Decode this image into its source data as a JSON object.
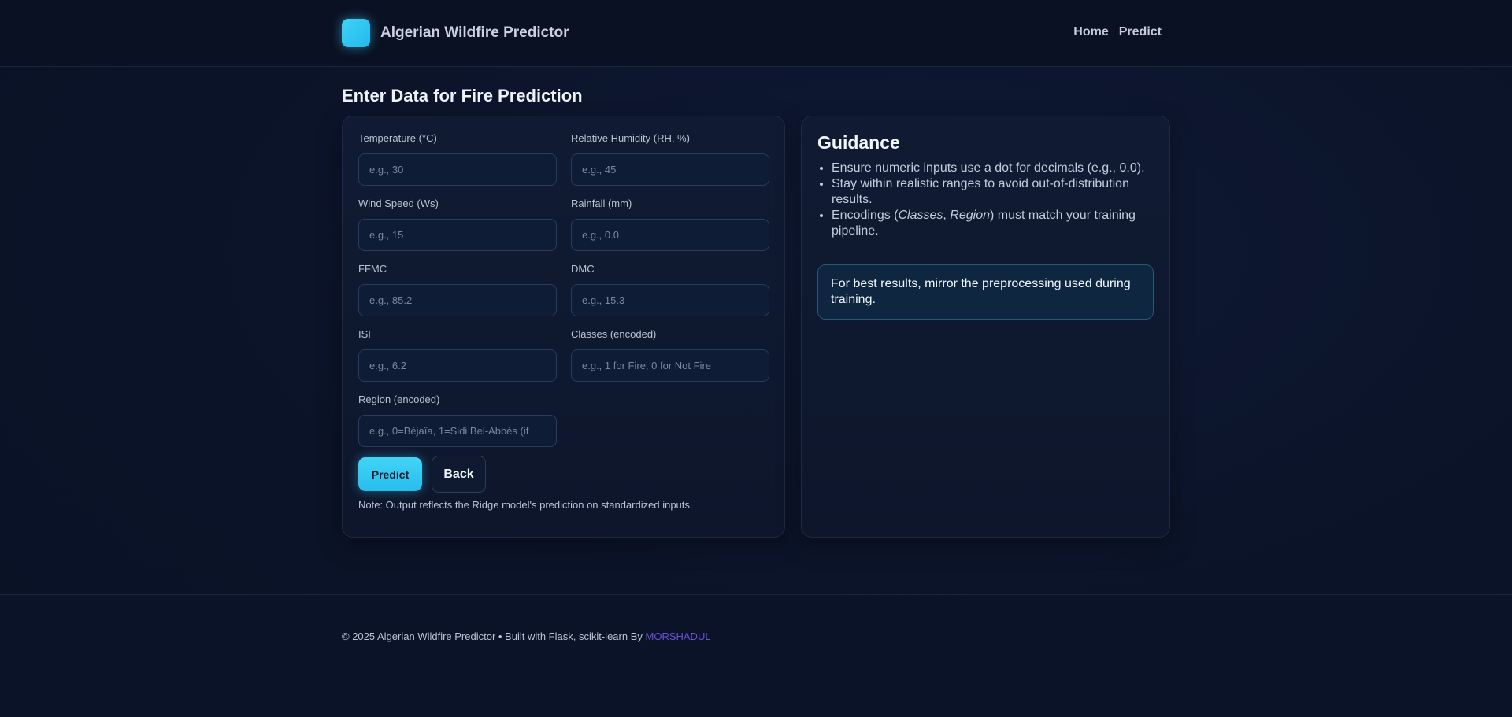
{
  "header": {
    "title": "Algerian Wildfire Predictor",
    "nav": {
      "home": "Home",
      "predict": "Predict"
    }
  },
  "page": {
    "title": "Enter Data for Fire Prediction"
  },
  "form": {
    "fields": [
      {
        "label": "Temperature (°C)",
        "placeholder": "e.g., 30",
        "value": ""
      },
      {
        "label": "Relative Humidity (RH, %)",
        "placeholder": "e.g., 45",
        "value": ""
      },
      {
        "label": "Wind Speed (Ws)",
        "placeholder": "e.g., 15",
        "value": ""
      },
      {
        "label": "Rainfall (mm)",
        "placeholder": "e.g., 0.0",
        "value": ""
      },
      {
        "label": "FFMC",
        "placeholder": "e.g., 85.2",
        "value": ""
      },
      {
        "label": "DMC",
        "placeholder": "e.g., 15.3",
        "value": ""
      },
      {
        "label": "ISI",
        "placeholder": "e.g., 6.2",
        "value": ""
      },
      {
        "label": "Classes (encoded)",
        "placeholder": "e.g., 1 for Fire, 0 for Not Fire",
        "value": ""
      },
      {
        "label": "Region (encoded)",
        "placeholder": "e.g., 0=Béjaïa, 1=Sidi Bel-Abbès (if",
        "value": ""
      }
    ],
    "predict_label": "Predict",
    "back_label": "Back",
    "note": "Note: Output reflects the Ridge model's prediction on standardized inputs."
  },
  "guidance": {
    "title": "Guidance",
    "items": [
      {
        "text": "Ensure numeric inputs use a dot for decimals (e.g., 0.0)."
      },
      {
        "pre": "Encodings (",
        "em1": "Classes",
        "mid": ", ",
        "em2": "Region",
        "post": ") must match your training pipeline."
      }
    ],
    "item_range": "Stay within realistic ranges to avoid out-of-distribution results.",
    "tip": "For best results, mirror the preprocessing used during training."
  },
  "footer": {
    "text": "© 2025 Algerian Wildfire Predictor • Built with Flask, scikit-learn By ",
    "author": "MORSHADUL"
  },
  "colors": {
    "accent": "#2fc6f2",
    "background": "#0b1328",
    "link": "#6b4fd6"
  }
}
